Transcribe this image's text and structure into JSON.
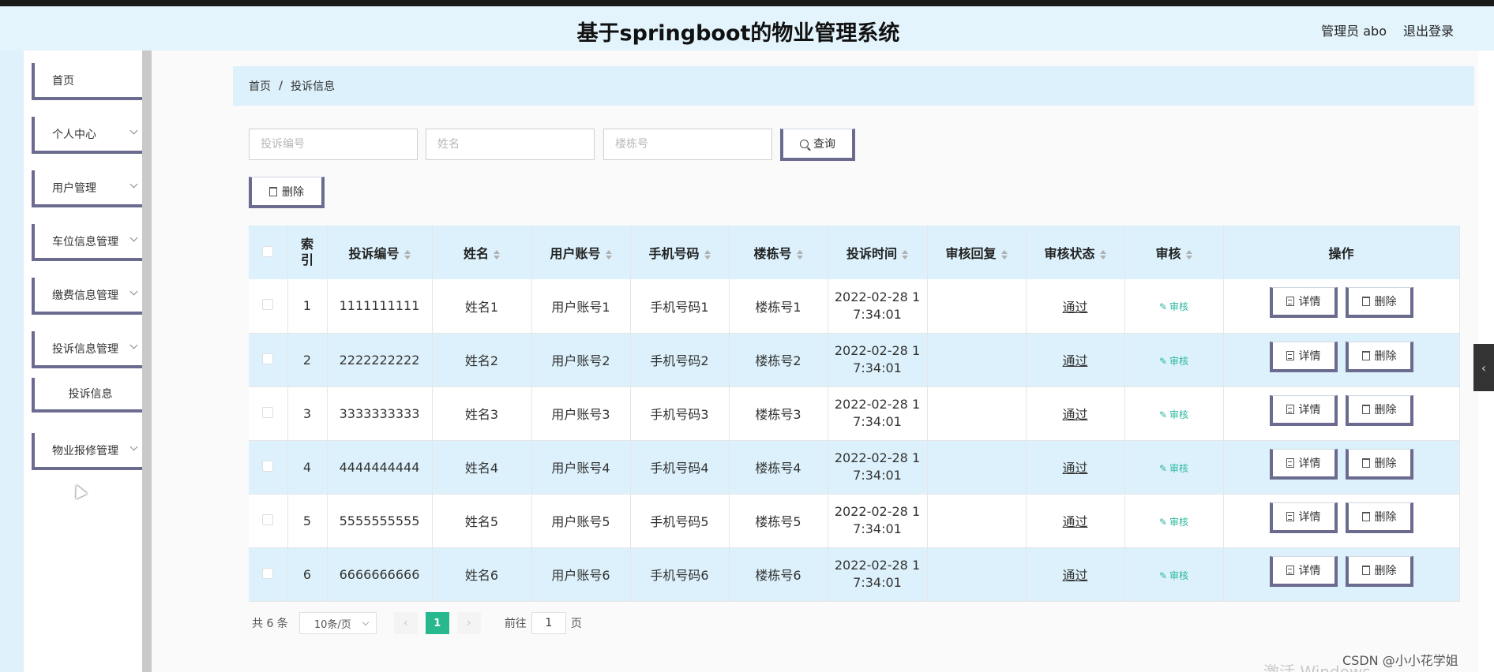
{
  "header": {
    "title": "基于springboot的物业管理系统",
    "user": "管理员 abo",
    "logout": "退出登录"
  },
  "sidebar": {
    "items": [
      {
        "label": "首页",
        "has_chevron": false
      },
      {
        "label": "个人中心",
        "has_chevron": true
      },
      {
        "label": "用户管理",
        "has_chevron": true
      },
      {
        "label": "车位信息管理",
        "has_chevron": true
      },
      {
        "label": "缴费信息管理",
        "has_chevron": true
      },
      {
        "label": "投诉信息管理",
        "has_chevron": true
      },
      {
        "label": "物业报修管理",
        "has_chevron": true
      }
    ],
    "subitem": "投诉信息"
  },
  "breadcrumb": {
    "home": "首页",
    "separator": "/",
    "current": "投诉信息"
  },
  "search": {
    "complaint_no_placeholder": "投诉编号",
    "name_placeholder": "姓名",
    "building_placeholder": "楼栋号",
    "query_label": "查询"
  },
  "toolbar": {
    "delete_label": "删除"
  },
  "table": {
    "headers": [
      "索引",
      "投诉编号",
      "姓名",
      "用户账号",
      "手机号码",
      "楼栋号",
      "投诉时间",
      "审核回复",
      "审核状态",
      "审核",
      "操作"
    ],
    "rows": [
      {
        "index": "1",
        "complaint_no": "1111111111",
        "name": "姓名1",
        "account": "用户账号1",
        "phone": "手机号码1",
        "building": "楼栋号1",
        "time_date": "2022-02-28 1",
        "time_clock": "7:34:01",
        "reply": "",
        "status": "通过",
        "audit": "审核"
      },
      {
        "index": "2",
        "complaint_no": "2222222222",
        "name": "姓名2",
        "account": "用户账号2",
        "phone": "手机号码2",
        "building": "楼栋号2",
        "time_date": "2022-02-28 1",
        "time_clock": "7:34:01",
        "reply": "",
        "status": "通过",
        "audit": "审核"
      },
      {
        "index": "3",
        "complaint_no": "3333333333",
        "name": "姓名3",
        "account": "用户账号3",
        "phone": "手机号码3",
        "building": "楼栋号3",
        "time_date": "2022-02-28 1",
        "time_clock": "7:34:01",
        "reply": "",
        "status": "通过",
        "audit": "审核"
      },
      {
        "index": "4",
        "complaint_no": "4444444444",
        "name": "姓名4",
        "account": "用户账号4",
        "phone": "手机号码4",
        "building": "楼栋号4",
        "time_date": "2022-02-28 1",
        "time_clock": "7:34:01",
        "reply": "",
        "status": "通过",
        "audit": "审核"
      },
      {
        "index": "5",
        "complaint_no": "5555555555",
        "name": "姓名5",
        "account": "用户账号5",
        "phone": "手机号码5",
        "building": "楼栋号5",
        "time_date": "2022-02-28 1",
        "time_clock": "7:34:01",
        "reply": "",
        "status": "通过",
        "audit": "审核"
      },
      {
        "index": "6",
        "complaint_no": "6666666666",
        "name": "姓名6",
        "account": "用户账号6",
        "phone": "手机号码6",
        "building": "楼栋号6",
        "time_date": "2022-02-28 1",
        "time_clock": "7:34:01",
        "reply": "",
        "status": "通过",
        "audit": "审核"
      }
    ],
    "detail_label": "详情",
    "delete_label": "删除"
  },
  "pagination": {
    "total": "共 6 条",
    "page_size": "10条/页",
    "current_page": "1",
    "goto_prefix": "前往",
    "goto_value": "1",
    "goto_suffix": "页"
  },
  "overlay": {
    "watermark": "CSDN @小小花学姐",
    "windows_mark": "激活 Windows"
  },
  "colors": {
    "header_bg": "#e3f4fc",
    "row_alt": "#dcf1fb",
    "button_border": "#6b6b8f",
    "accent_green": "#27b88f",
    "audit_link": "#2bb7a0"
  }
}
